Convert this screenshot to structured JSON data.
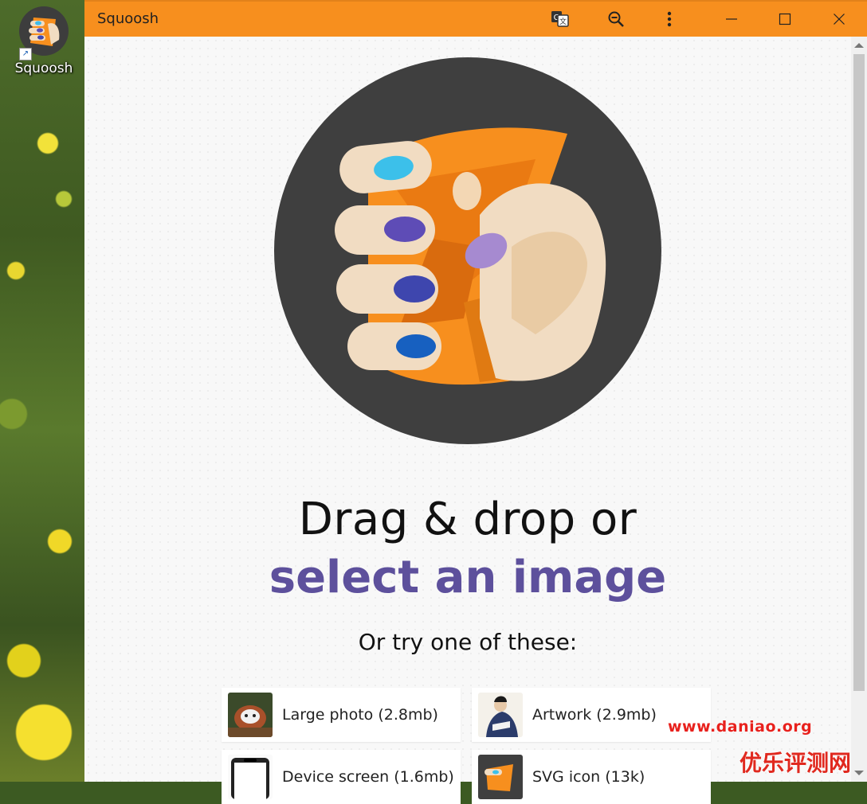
{
  "desktop": {
    "icon_label": "Squoosh"
  },
  "window": {
    "title": "Squoosh",
    "accent_color": "#f78f1e",
    "controls": {
      "translate": "translate-icon",
      "zoom": "zoom-icon",
      "menu": "more-vert-icon",
      "minimize": "–",
      "maximize": "☐",
      "close": "✕"
    }
  },
  "main": {
    "headline_line1": "Drag & drop or",
    "headline_line2": "select an image",
    "headline_link_color": "#5d509c",
    "try_text": "Or try one of these:",
    "demos": [
      {
        "label": "Large photo (2.8mb)"
      },
      {
        "label": "Artwork (2.9mb)"
      },
      {
        "label": "Device screen (1.6mb)"
      },
      {
        "label": "SVG icon (13k)"
      }
    ]
  },
  "watermark": {
    "url": "www.daniao.org",
    "site": "优乐评测网"
  }
}
